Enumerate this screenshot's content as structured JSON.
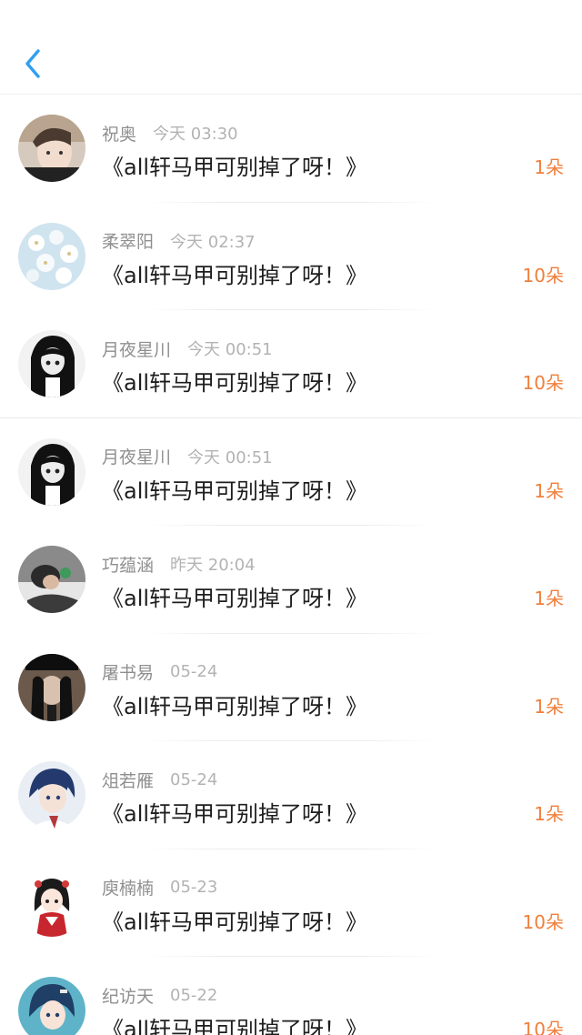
{
  "header": {
    "back_icon": "chevron-left-icon",
    "accent_color": "#2f9ff0"
  },
  "accent_colors": {
    "gift_count": "#f07f3c",
    "name": "#8f8f8f",
    "time": "#b3b3b3"
  },
  "rows": [
    {
      "name": "祝奥",
      "time": "今天 03:30",
      "title": "《all轩马甲可别掉了呀！》",
      "gift": "1朵",
      "avatar_style": "boy-selfie"
    },
    {
      "name": "柔翠阳",
      "time": "今天 02:37",
      "title": "《all轩马甲可别掉了呀！》",
      "gift": "10朵",
      "avatar_style": "white-blossoms"
    },
    {
      "name": "月夜星川",
      "time": "今天 00:51",
      "title": "《all轩马甲可别掉了呀！》",
      "gift": "10朵",
      "avatar_style": "monochrome-anime-girl"
    },
    {
      "name": "月夜星川",
      "time": "今天 00:51",
      "title": "《all轩马甲可别掉了呀！》",
      "gift": "1朵",
      "avatar_style": "monochrome-anime-girl"
    },
    {
      "name": "巧蕴涵",
      "time": "昨天 20:04",
      "title": "《all轩马甲可别掉了呀！》",
      "gift": "1朵",
      "avatar_style": "person-lying"
    },
    {
      "name": "屠书易",
      "time": "05-24",
      "title": "《all轩马甲可别掉了呀！》",
      "gift": "1朵",
      "avatar_style": "dark-hat-figure"
    },
    {
      "name": "俎若雁",
      "time": "05-24",
      "title": "《all轩马甲可别掉了呀！》",
      "gift": "1朵",
      "avatar_style": "anime-boy-blue-hair"
    },
    {
      "name": "庾楠楠",
      "time": "05-23",
      "title": "《all轩马甲可别掉了呀！》",
      "gift": "10朵",
      "avatar_style": "chibi-girl-red"
    },
    {
      "name": "纪访天",
      "time": "05-22",
      "title": "《all轩马甲可别掉了呀！》",
      "gift": "10朵",
      "avatar_style": "anime-boy-teal"
    }
  ]
}
